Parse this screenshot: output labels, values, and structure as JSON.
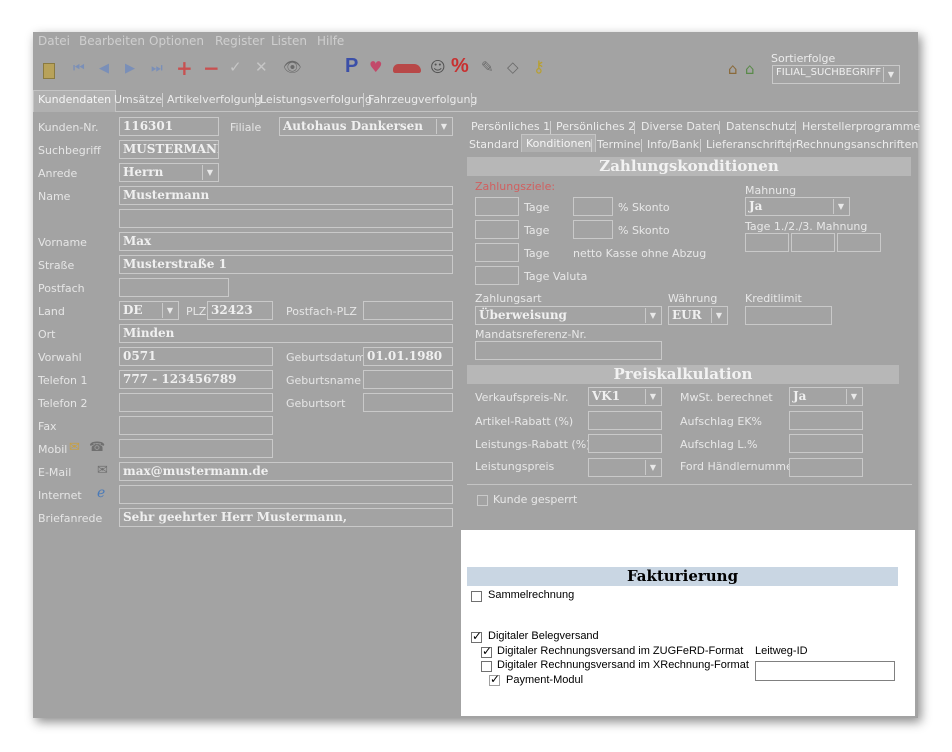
{
  "menu": [
    "Datei",
    "Bearbeiten",
    "Optionen",
    "Register",
    "Listen",
    "Hilfe"
  ],
  "toolbar": {
    "sort_label": "Sortierfolge",
    "sort_value": "FILIAL_SUCHBEGRIFF",
    "p_icon": "P",
    "percent_icon": "%"
  },
  "tabs": [
    "Kundendaten",
    "Umsätze",
    "Artikelverfolgung",
    "Leistungsverfolgung",
    "Fahrzeugverfolgung"
  ],
  "customer": {
    "kunden_nr_label": "Kunden-Nr.",
    "kunden_nr": "116301",
    "filiale_label": "Filiale",
    "filiale": "Autohaus Dankersen",
    "suchbegriff_label": "Suchbegriff",
    "suchbegriff": "MUSTERMANN",
    "anrede_label": "Anrede",
    "anrede": "Herrn",
    "name_label": "Name",
    "name": "Mustermann",
    "vorname_label": "Vorname",
    "vorname": "Max",
    "strasse_label": "Straße",
    "strasse": "Musterstraße 1",
    "postfach_label": "Postfach",
    "land_label": "Land",
    "land": "DE",
    "plz_label": "PLZ",
    "plz": "32423",
    "postfach_plz_label": "Postfach-PLZ",
    "ort_label": "Ort",
    "ort": "Minden",
    "vorwahl_label": "Vorwahl",
    "vorwahl": "0571",
    "geburtsdatum_label": "Geburtsdatum",
    "geburtsdatum": "01.01.1980",
    "telefon1_label": "Telefon 1",
    "telefon1": "777 - 123456789",
    "geburtsname_label": "Geburtsname",
    "telefon2_label": "Telefon 2",
    "geburtsort_label": "Geburtsort",
    "fax_label": "Fax",
    "mobil_label": "Mobil",
    "email_label": "E-Mail",
    "email": "max@mustermann.de",
    "internet_label": "Internet",
    "briefanrede_label": "Briefanrede",
    "briefanrede": "Sehr geehrter Herr Mustermann,"
  },
  "right_tabs_row1": [
    "Persönliches 1",
    "Persönliches 2",
    "Diverse Daten",
    "Datenschutz",
    "Herstellerprogramme"
  ],
  "right_tabs_row2": [
    "Standard",
    "Konditionen",
    "Termine",
    "Info/Bank",
    "Lieferanschriften",
    "Rechnungsanschriften"
  ],
  "zahlung": {
    "title": "Zahlungskonditionen",
    "ziele_label": "Zahlungsziele:",
    "tage": "Tage",
    "skonto": "% Skonto",
    "netto": "netto Kasse ohne Abzug",
    "valuta": "Tage Valuta",
    "mahnung_label": "Mahnung",
    "mahnung": "Ja",
    "mahn_tage_label": "Tage 1./2./3. Mahnung",
    "zahlungsart_label": "Zahlungsart",
    "zahlungsart": "Überweisung",
    "waehrung_label": "Währung",
    "waehrung": "EUR",
    "kreditlimit_label": "Kreditlimit",
    "mandat_label": "Mandatsreferenz-Nr."
  },
  "preis": {
    "title": "Preiskalkulation",
    "vk_label": "Verkaufspreis-Nr.",
    "vk": "VK1",
    "mwst_label": "MwSt. berechnet",
    "mwst": "Ja",
    "artikel_rabatt": "Artikel-Rabatt (%)",
    "aufschlag_ek": "Aufschlag EK%",
    "leistungs_rabatt": "Leistungs-Rabatt (%)",
    "aufschlag_l": "Aufschlag L.%",
    "leistungspreis": "Leistungspreis",
    "ford": "Ford Händlernummer",
    "gesperrt": "Kunde gesperrt"
  },
  "faktura": {
    "title": "Fakturierung",
    "sammel": "Sammelrechnung",
    "digital": "Digitaler Belegversand",
    "zugferd": "Digitaler Rechnungsversand im ZUGFeRD-Format",
    "xrechnung": "Digitaler Rechnungsversand im XRechnung-Format",
    "payment": "Payment-Modul",
    "leitweg_label": "Leitweg-ID",
    "leitweg": ""
  }
}
